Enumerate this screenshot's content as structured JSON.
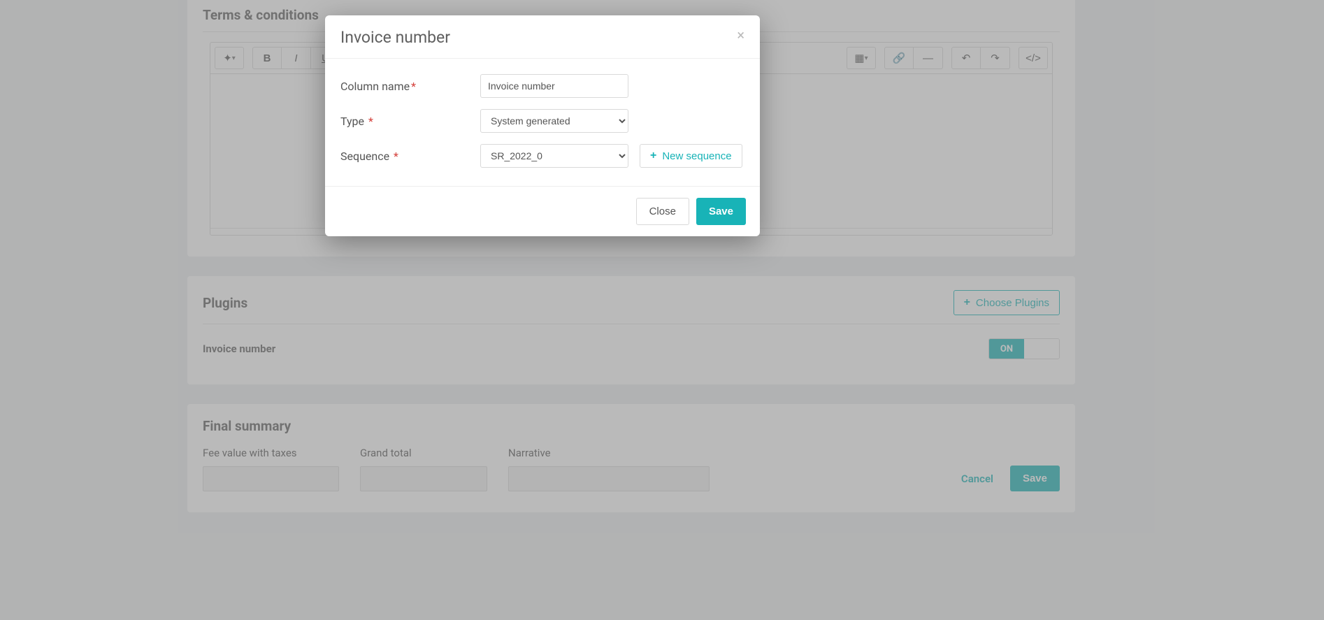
{
  "terms": {
    "title": "Terms & conditions"
  },
  "plugins": {
    "title": "Plugins",
    "choose": "Choose Plugins",
    "row": {
      "name": "Invoice number",
      "toggle_on": "ON"
    }
  },
  "summary": {
    "title": "Final summary",
    "fee_label": "Fee value with taxes",
    "grand_label": "Grand total",
    "narrative_label": "Narrative",
    "cancel": "Cancel",
    "save": "Save"
  },
  "modal": {
    "title": "Invoice number",
    "column_name_label": "Column name",
    "column_name_value": "Invoice number",
    "type_label": "Type",
    "type_value": "System generated",
    "sequence_label": "Sequence",
    "sequence_value": "SR_2022_0",
    "new_sequence": "New sequence",
    "close": "Close",
    "save": "Save"
  },
  "toolbar": {
    "magic": "✦",
    "bold": "B",
    "italic": "I",
    "underline": "U",
    "table": "▦",
    "link": "🔗",
    "hr": "—",
    "undo": "↶",
    "redo": "↷",
    "code": "</>"
  }
}
